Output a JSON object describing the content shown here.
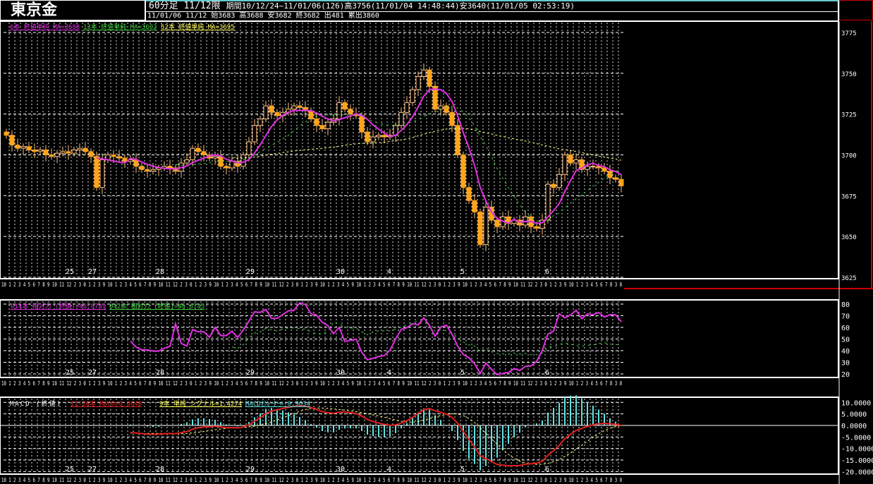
{
  "header": {
    "instrument": "東京金",
    "timeframe": "60分足 11/12限",
    "period": "期間10/12/24~11/01/06(126)高3756(11/01/04 14:48:44)安3640(11/01/05 02:53:19)",
    "last_bar": "11/01/06 11/12 始3683 高3688 安3682 終3682 出481 累出3860"
  },
  "legends": {
    "ma6": "6本 終値単純 MA=3688",
    "ma13": "13本 終値単純 MA=3692",
    "ma52": "52本 終値単純 MA=3695",
    "rsi14": "014本 相対力 (終値)=46.8749",
    "rsi42": "042本 相対力 (終値)=46.8743",
    "macd_title": "MACD (終値)",
    "macd": "12-26本 MACD=0.4640",
    "signal": "9本 単純 シグナル=1.4274",
    "osc": "MACDｵｼﾚｰﾀｰ=-0.9634"
  },
  "colors": {
    "candle": "#ffa31a",
    "ma6": "#e030e0",
    "ma13": "#40d040",
    "ma52": "#ffff80",
    "macd": "#e02020",
    "signal": "#ffff80",
    "osc": "#60e0e0",
    "rsi14": "#e030e0",
    "rsi42": "#40d040"
  },
  "x_axis_hours": "10 1 2 3 4 5 6 7 8 9 10 11 12 2 3 0 1 2 3 9 10 1 2 3 4 5 6 7 8 9 10 11 12 2 3 0 1 2 3 9 10 1 2 3 4 5 6 7 8 9 10 11 12 2 3 0 1 2 3 9 10 1 2 3 4 5 9 10 1 2 3 4 5 6 7 8 9 10 11 12 2 3 0 1 2 3 9 10 1 2 3 4 5 6 7 8 9 10 11 12 2 3 0 1 2 3 9 10 1 2 3 4 5 6 7 8 3 0",
  "chart_data": {
    "type": "candlestick",
    "main_axis": {
      "ylim": [
        3625,
        3775
      ],
      "ticks": [
        "3775",
        "3750",
        "3725",
        "3700",
        "3675",
        "3650",
        "3625"
      ]
    },
    "rsi_axis": {
      "ylim": [
        20,
        80
      ],
      "ticks": [
        "80",
        "70",
        "60",
        "50",
        "40",
        "30",
        "20"
      ]
    },
    "macd_axis": {
      "ylim": [
        -20,
        10
      ],
      "ticks": [
        "10.0000",
        "5.0000",
        "0.0000",
        "-5.0000",
        "-10.0000",
        "-15.0000",
        "-20.0000"
      ]
    },
    "day_labels": [
      {
        "label": "25",
        "index": 11
      },
      {
        "label": "27",
        "index": 15
      },
      {
        "label": "28",
        "index": 27
      },
      {
        "label": "29",
        "index": 43
      },
      {
        "label": "30",
        "index": 59
      },
      {
        "label": "4",
        "index": 68
      },
      {
        "label": "5",
        "index": 81
      },
      {
        "label": "6",
        "index": 96
      }
    ],
    "close": [
      3712,
      3706,
      3704,
      3705,
      3703,
      3702,
      3703,
      3700,
      3699,
      3701,
      3702,
      3701,
      3703,
      3704,
      3702,
      3699,
      3680,
      3697,
      3700,
      3699,
      3698,
      3696,
      3697,
      3693,
      3691,
      3690,
      3691,
      3692,
      3693,
      3692,
      3690,
      3695,
      3697,
      3704,
      3702,
      3700,
      3698,
      3699,
      3693,
      3692,
      3696,
      3693,
      3700,
      3708,
      3718,
      3722,
      3730,
      3726,
      3724,
      3726,
      3728,
      3730,
      3729,
      3727,
      3722,
      3718,
      3716,
      3720,
      3722,
      3732,
      3728,
      3725,
      3724,
      3714,
      3708,
      3711,
      3712,
      3711,
      3712,
      3718,
      3726,
      3732,
      3740,
      3748,
      3752,
      3742,
      3728,
      3730,
      3726,
      3718,
      3700,
      3680,
      3672,
      3665,
      3645,
      3668,
      3660,
      3656,
      3662,
      3658,
      3660,
      3657,
      3662,
      3656,
      3655,
      3660,
      3682,
      3680,
      3688,
      3700,
      3695,
      3697,
      3691,
      3693,
      3693,
      3692,
      3690,
      3686,
      3685,
      3681
    ]
  }
}
